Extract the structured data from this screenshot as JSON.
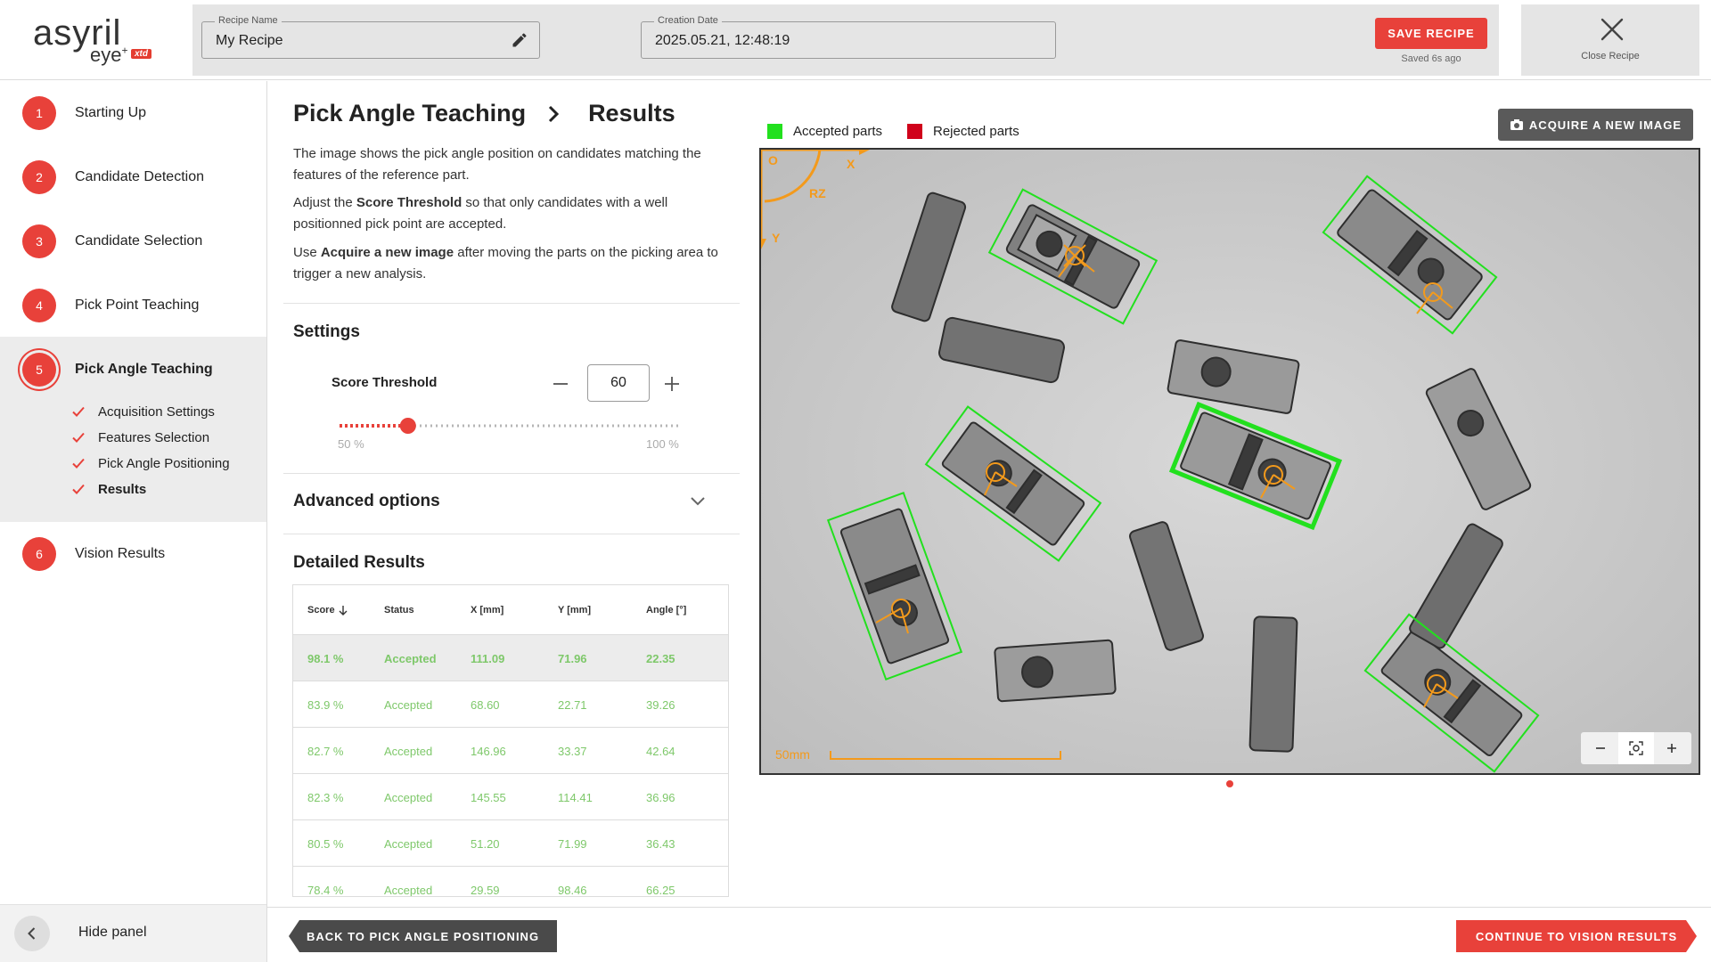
{
  "brand": {
    "name": "asyril",
    "product": "eye",
    "plus": "+",
    "edition": "xtd"
  },
  "header": {
    "recipe_name_label": "Recipe Name",
    "recipe_name_value": "My Recipe",
    "creation_date_label": "Creation Date",
    "creation_date_value": "2025.05.21, 12:48:19",
    "save_label": "SAVE RECIPE",
    "saved_ago": "Saved 6s ago",
    "close_label": "Close Recipe"
  },
  "sidebar": {
    "steps": [
      {
        "num": "1",
        "label": "Starting Up"
      },
      {
        "num": "2",
        "label": "Candidate Detection"
      },
      {
        "num": "3",
        "label": "Candidate Selection"
      },
      {
        "num": "4",
        "label": "Pick Point Teaching"
      },
      {
        "num": "5",
        "label": "Pick Angle Teaching"
      },
      {
        "num": "6",
        "label": "Vision Results"
      }
    ],
    "substeps": [
      {
        "label": "Acquisition Settings"
      },
      {
        "label": "Features Selection"
      },
      {
        "label": "Pick Angle Positioning"
      },
      {
        "label": "Results"
      }
    ],
    "hide_label": "Hide panel"
  },
  "main": {
    "title": "Pick Angle Teaching",
    "subtitle": "Results",
    "desc1": "The image shows the pick angle position on candidates matching the features of the reference part.",
    "desc2_pre": "Adjust the ",
    "desc2_bold": "Score Threshold",
    "desc2_post": " so that only candidates with a well positionned pick point are accepted.",
    "desc3_pre": "Use ",
    "desc3_bold": "Acquire a new image",
    "desc3_post": " after moving the parts on the picking area to trigger a new analysis.",
    "settings_title": "Settings",
    "score_label": "Score Threshold",
    "score_value": "60",
    "slider_min": "50 %",
    "slider_max": "100 %",
    "slider_fraction": 0.2,
    "advanced_title": "Advanced options",
    "detailed_title": "Detailed Results"
  },
  "table": {
    "headers": {
      "score": "Score",
      "status": "Status",
      "x": "X [mm]",
      "y": "Y [mm]",
      "angle": "Angle [°]"
    },
    "rows": [
      {
        "score": "98.1 %",
        "status": "Accepted",
        "x": "111.09",
        "y": "71.96",
        "angle": "22.35"
      },
      {
        "score": "83.9 %",
        "status": "Accepted",
        "x": "68.60",
        "y": "22.71",
        "angle": "39.26"
      },
      {
        "score": "82.7 %",
        "status": "Accepted",
        "x": "146.96",
        "y": "33.37",
        "angle": "42.64"
      },
      {
        "score": "82.3 %",
        "status": "Accepted",
        "x": "145.55",
        "y": "114.41",
        "angle": "36.96"
      },
      {
        "score": "80.5 %",
        "status": "Accepted",
        "x": "51.20",
        "y": "71.99",
        "angle": "36.43"
      },
      {
        "score": "78.4 %",
        "status": "Accepted",
        "x": "29.59",
        "y": "98.46",
        "angle": "66.25"
      }
    ]
  },
  "image": {
    "legend_accepted": "Accepted parts",
    "legend_rejected": "Rejected parts",
    "acquire_label": "ACQUIRE A NEW IMAGE",
    "axis_o": "O",
    "axis_x": "X",
    "axis_y": "Y",
    "axis_rz": "RZ",
    "scale_label": "50mm"
  },
  "footer": {
    "back_label": "BACK TO PICK ANGLE POSITIONING",
    "continue_label": "CONTINUE TO VISION RESULTS"
  },
  "colors": {
    "accent": "#e8413a",
    "accepted": "#22e01e",
    "rejected": "#d0021b",
    "overlay": "#f39a1c"
  },
  "icons": [
    "pencil-icon",
    "close-icon",
    "check-icon",
    "chevron-right-icon",
    "chevron-down-icon",
    "chevron-left-icon",
    "minus-icon",
    "plus-icon",
    "camera-icon",
    "arrow-down-icon",
    "zoom-out-icon",
    "zoom-fit-icon",
    "zoom-in-icon"
  ]
}
